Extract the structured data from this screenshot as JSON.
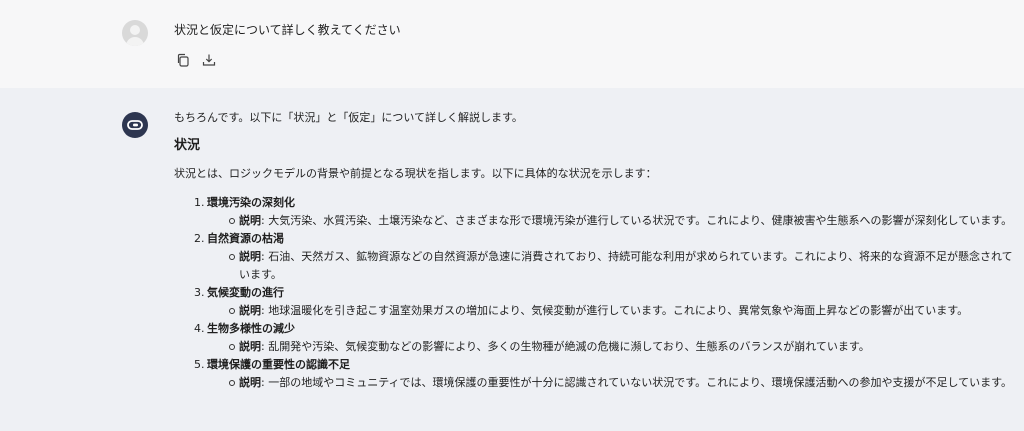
{
  "user": {
    "message": "状況と仮定について詳しく教えてください",
    "actions": [
      "copy-icon",
      "download-icon"
    ]
  },
  "assistant": {
    "intro": "もちろんです。以下に「状況」と「仮定」について詳しく解説します。",
    "section_heading": "状況",
    "lead": "状況とは、ロジックモデルの背景や前提となる現状を指します。以下に具体的な状況を示します：",
    "items": [
      {
        "num": "1.",
        "title": "環境汚染の深刻化",
        "label": "説明",
        "desc": ": 大気汚染、水質汚染、土壌汚染など、さまざまな形で環境汚染が進行している状況です。これにより、健康被害や生態系への影響が深刻化しています。"
      },
      {
        "num": "2.",
        "title": "自然資源の枯渇",
        "label": "説明",
        "desc": ": 石油、天然ガス、鉱物資源などの自然資源が急速に消費されており、持続可能な利用が求められています。これにより、将来的な資源不足が懸念されています。"
      },
      {
        "num": "3.",
        "title": "気候変動の進行",
        "label": "説明",
        "desc": ": 地球温暖化を引き起こす温室効果ガスの増加により、気候変動が進行しています。これにより、異常気象や海面上昇などの影響が出ています。"
      },
      {
        "num": "4.",
        "title": "生物多様性の減少",
        "label": "説明",
        "desc": ": 乱開発や汚染、気候変動などの影響により、多くの生物種が絶滅の危機に瀕しており、生態系のバランスが崩れています。"
      },
      {
        "num": "5.",
        "title": "環境保護の重要性の認識不足",
        "label": "説明",
        "desc": ": 一部の地域やコミュニティでは、環境保護の重要性が十分に認識されていない状況です。これにより、環境保護活動への参加や支援が不足しています。"
      }
    ]
  },
  "colors": {
    "user_bg": "#f7f7f8",
    "assistant_bg": "#eef0f4",
    "bot_avatar": "#2d3650"
  }
}
